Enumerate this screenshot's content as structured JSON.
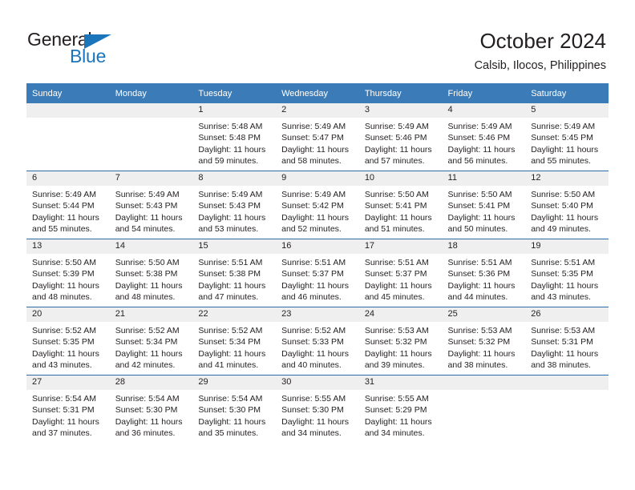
{
  "brand": {
    "name_dark": "General",
    "name_blue": "Blue",
    "accent_color": "#1b75bb"
  },
  "header": {
    "title": "October 2024",
    "location": "Calsib, Ilocos, Philippines",
    "header_bg_color": "#3b7cb8",
    "grid_line_color": "#2d6ca8",
    "daynum_bg_color": "#efefef"
  },
  "weekdays": [
    "Sunday",
    "Monday",
    "Tuesday",
    "Wednesday",
    "Thursday",
    "Friday",
    "Saturday"
  ],
  "labels": {
    "sunrise_prefix": "Sunrise:",
    "sunset_prefix": "Sunset:",
    "daylight_prefix": "Daylight:"
  },
  "weeks": [
    [
      {
        "blank": true,
        "day": ""
      },
      {
        "blank": true,
        "day": ""
      },
      {
        "blank": false,
        "day": "1",
        "sunrise": "Sunrise: 5:48 AM",
        "sunset": "Sunset: 5:48 PM",
        "daylight": "Daylight: 11 hours and 59 minutes."
      },
      {
        "blank": false,
        "day": "2",
        "sunrise": "Sunrise: 5:49 AM",
        "sunset": "Sunset: 5:47 PM",
        "daylight": "Daylight: 11 hours and 58 minutes."
      },
      {
        "blank": false,
        "day": "3",
        "sunrise": "Sunrise: 5:49 AM",
        "sunset": "Sunset: 5:46 PM",
        "daylight": "Daylight: 11 hours and 57 minutes."
      },
      {
        "blank": false,
        "day": "4",
        "sunrise": "Sunrise: 5:49 AM",
        "sunset": "Sunset: 5:46 PM",
        "daylight": "Daylight: 11 hours and 56 minutes."
      },
      {
        "blank": false,
        "day": "5",
        "sunrise": "Sunrise: 5:49 AM",
        "sunset": "Sunset: 5:45 PM",
        "daylight": "Daylight: 11 hours and 55 minutes."
      }
    ],
    [
      {
        "blank": false,
        "day": "6",
        "sunrise": "Sunrise: 5:49 AM",
        "sunset": "Sunset: 5:44 PM",
        "daylight": "Daylight: 11 hours and 55 minutes."
      },
      {
        "blank": false,
        "day": "7",
        "sunrise": "Sunrise: 5:49 AM",
        "sunset": "Sunset: 5:43 PM",
        "daylight": "Daylight: 11 hours and 54 minutes."
      },
      {
        "blank": false,
        "day": "8",
        "sunrise": "Sunrise: 5:49 AM",
        "sunset": "Sunset: 5:43 PM",
        "daylight": "Daylight: 11 hours and 53 minutes."
      },
      {
        "blank": false,
        "day": "9",
        "sunrise": "Sunrise: 5:49 AM",
        "sunset": "Sunset: 5:42 PM",
        "daylight": "Daylight: 11 hours and 52 minutes."
      },
      {
        "blank": false,
        "day": "10",
        "sunrise": "Sunrise: 5:50 AM",
        "sunset": "Sunset: 5:41 PM",
        "daylight": "Daylight: 11 hours and 51 minutes."
      },
      {
        "blank": false,
        "day": "11",
        "sunrise": "Sunrise: 5:50 AM",
        "sunset": "Sunset: 5:41 PM",
        "daylight": "Daylight: 11 hours and 50 minutes."
      },
      {
        "blank": false,
        "day": "12",
        "sunrise": "Sunrise: 5:50 AM",
        "sunset": "Sunset: 5:40 PM",
        "daylight": "Daylight: 11 hours and 49 minutes."
      }
    ],
    [
      {
        "blank": false,
        "day": "13",
        "sunrise": "Sunrise: 5:50 AM",
        "sunset": "Sunset: 5:39 PM",
        "daylight": "Daylight: 11 hours and 48 minutes."
      },
      {
        "blank": false,
        "day": "14",
        "sunrise": "Sunrise: 5:50 AM",
        "sunset": "Sunset: 5:38 PM",
        "daylight": "Daylight: 11 hours and 48 minutes."
      },
      {
        "blank": false,
        "day": "15",
        "sunrise": "Sunrise: 5:51 AM",
        "sunset": "Sunset: 5:38 PM",
        "daylight": "Daylight: 11 hours and 47 minutes."
      },
      {
        "blank": false,
        "day": "16",
        "sunrise": "Sunrise: 5:51 AM",
        "sunset": "Sunset: 5:37 PM",
        "daylight": "Daylight: 11 hours and 46 minutes."
      },
      {
        "blank": false,
        "day": "17",
        "sunrise": "Sunrise: 5:51 AM",
        "sunset": "Sunset: 5:37 PM",
        "daylight": "Daylight: 11 hours and 45 minutes."
      },
      {
        "blank": false,
        "day": "18",
        "sunrise": "Sunrise: 5:51 AM",
        "sunset": "Sunset: 5:36 PM",
        "daylight": "Daylight: 11 hours and 44 minutes."
      },
      {
        "blank": false,
        "day": "19",
        "sunrise": "Sunrise: 5:51 AM",
        "sunset": "Sunset: 5:35 PM",
        "daylight": "Daylight: 11 hours and 43 minutes."
      }
    ],
    [
      {
        "blank": false,
        "day": "20",
        "sunrise": "Sunrise: 5:52 AM",
        "sunset": "Sunset: 5:35 PM",
        "daylight": "Daylight: 11 hours and 43 minutes."
      },
      {
        "blank": false,
        "day": "21",
        "sunrise": "Sunrise: 5:52 AM",
        "sunset": "Sunset: 5:34 PM",
        "daylight": "Daylight: 11 hours and 42 minutes."
      },
      {
        "blank": false,
        "day": "22",
        "sunrise": "Sunrise: 5:52 AM",
        "sunset": "Sunset: 5:34 PM",
        "daylight": "Daylight: 11 hours and 41 minutes."
      },
      {
        "blank": false,
        "day": "23",
        "sunrise": "Sunrise: 5:52 AM",
        "sunset": "Sunset: 5:33 PM",
        "daylight": "Daylight: 11 hours and 40 minutes."
      },
      {
        "blank": false,
        "day": "24",
        "sunrise": "Sunrise: 5:53 AM",
        "sunset": "Sunset: 5:32 PM",
        "daylight": "Daylight: 11 hours and 39 minutes."
      },
      {
        "blank": false,
        "day": "25",
        "sunrise": "Sunrise: 5:53 AM",
        "sunset": "Sunset: 5:32 PM",
        "daylight": "Daylight: 11 hours and 38 minutes."
      },
      {
        "blank": false,
        "day": "26",
        "sunrise": "Sunrise: 5:53 AM",
        "sunset": "Sunset: 5:31 PM",
        "daylight": "Daylight: 11 hours and 38 minutes."
      }
    ],
    [
      {
        "blank": false,
        "day": "27",
        "sunrise": "Sunrise: 5:54 AM",
        "sunset": "Sunset: 5:31 PM",
        "daylight": "Daylight: 11 hours and 37 minutes."
      },
      {
        "blank": false,
        "day": "28",
        "sunrise": "Sunrise: 5:54 AM",
        "sunset": "Sunset: 5:30 PM",
        "daylight": "Daylight: 11 hours and 36 minutes."
      },
      {
        "blank": false,
        "day": "29",
        "sunrise": "Sunrise: 5:54 AM",
        "sunset": "Sunset: 5:30 PM",
        "daylight": "Daylight: 11 hours and 35 minutes."
      },
      {
        "blank": false,
        "day": "30",
        "sunrise": "Sunrise: 5:55 AM",
        "sunset": "Sunset: 5:30 PM",
        "daylight": "Daylight: 11 hours and 34 minutes."
      },
      {
        "blank": false,
        "day": "31",
        "sunrise": "Sunrise: 5:55 AM",
        "sunset": "Sunset: 5:29 PM",
        "daylight": "Daylight: 11 hours and 34 minutes."
      },
      {
        "blank": true,
        "day": ""
      },
      {
        "blank": true,
        "day": ""
      }
    ]
  ]
}
